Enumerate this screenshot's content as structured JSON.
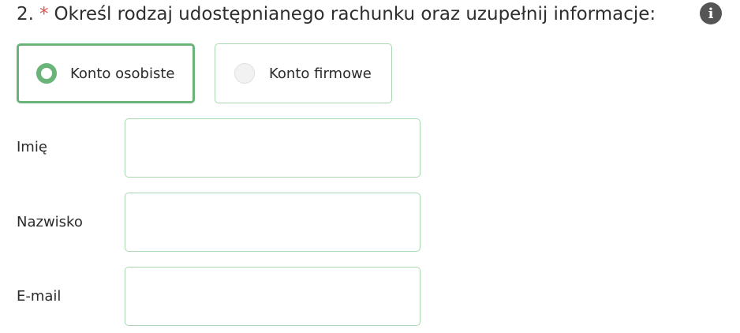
{
  "question": {
    "number": "2.",
    "required_mark": "*",
    "text": "Określ rodzaj udostępnianego rachunku oraz uzupełnij informacje:"
  },
  "info_icon": {
    "glyph": "i",
    "icon": "info-icon"
  },
  "account_type": {
    "options": [
      {
        "label": "Konto osobiste",
        "selected": true
      },
      {
        "label": "Konto firmowe",
        "selected": false
      }
    ]
  },
  "fields": [
    {
      "label": "Imię",
      "value": "",
      "placeholder": ""
    },
    {
      "label": "Nazwisko",
      "value": "",
      "placeholder": ""
    },
    {
      "label": "E-mail",
      "value": "",
      "placeholder": ""
    }
  ],
  "colors": {
    "accent_green": "#6ab47a",
    "input_border": "#a9d8b0",
    "required_red": "#d9534f",
    "info_icon_bg": "#555555"
  }
}
